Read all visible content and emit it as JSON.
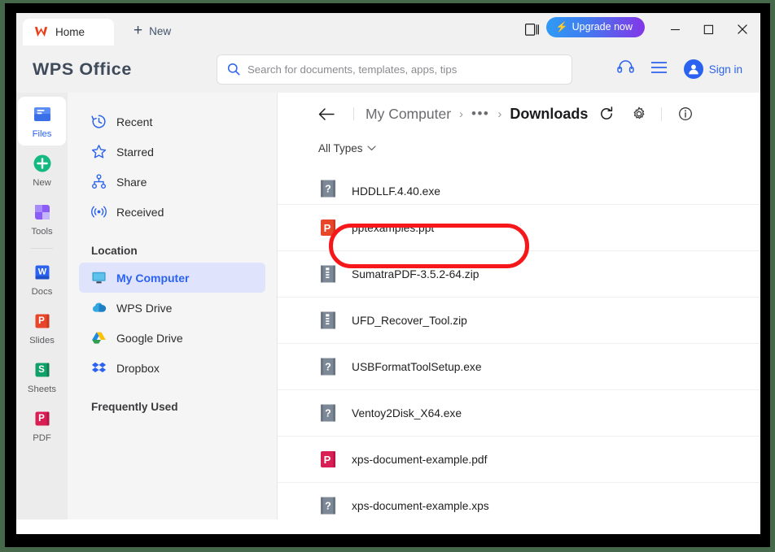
{
  "window": {
    "tabs": [
      {
        "label": "Home",
        "icon": "wps-logo-icon"
      }
    ],
    "new_tab_label": "New",
    "upgrade_label": "Upgrade now",
    "upgrade_icon": "lightning-bolt-icon",
    "sidebar_toggle_icon": "side-panel-icon",
    "minimize_icon": "minimize-icon",
    "maximize_icon": "maximize-icon",
    "close_icon": "close-icon"
  },
  "header": {
    "brand": "WPS Office",
    "search": {
      "placeholder": "Search for documents, templates, apps, tips",
      "icon": "search-icon"
    },
    "support_icon": "headset-icon",
    "menu_icon": "hamburger-menu-icon",
    "account": {
      "label": "Sign in",
      "icon": "user-avatar-icon"
    }
  },
  "rail": {
    "items": [
      {
        "label": "Files",
        "icon": "files-icon",
        "active": true
      },
      {
        "label": "New",
        "icon": "plus-circle-icon",
        "active": false
      },
      {
        "label": "Tools",
        "icon": "tools-grid-icon",
        "active": false
      },
      {
        "label": "Docs",
        "icon": "word-doc-icon",
        "active": false
      },
      {
        "label": "Slides",
        "icon": "powerpoint-icon",
        "active": false
      },
      {
        "label": "Sheets",
        "icon": "spreadsheet-icon",
        "active": false
      },
      {
        "label": "PDF",
        "icon": "pdf-icon",
        "active": false
      }
    ]
  },
  "nav": {
    "top_items": [
      {
        "label": "Recent",
        "icon": "history-clock-icon"
      },
      {
        "label": "Starred",
        "icon": "star-icon"
      },
      {
        "label": "Share",
        "icon": "share-nodes-icon"
      },
      {
        "label": "Received",
        "icon": "broadcast-icon"
      }
    ],
    "location_heading": "Location",
    "location_items": [
      {
        "label": "My Computer",
        "icon": "monitor-icon",
        "selected": true
      },
      {
        "label": "WPS Drive",
        "icon": "cloud-icon",
        "selected": false
      },
      {
        "label": "Google Drive",
        "icon": "google-drive-icon",
        "selected": false
      },
      {
        "label": "Dropbox",
        "icon": "dropbox-icon",
        "selected": false
      }
    ],
    "frequently_used_heading": "Frequently Used"
  },
  "content": {
    "breadcrumb": {
      "back_icon": "arrow-left-icon",
      "root": "My Computer",
      "ellipsis": "•••",
      "current": "Downloads",
      "refresh_icon": "refresh-icon",
      "settings_icon": "gear-icon",
      "info_icon": "info-icon"
    },
    "filter": {
      "label": "All Types",
      "icon": "chevron-down-icon"
    },
    "files": [
      {
        "name": "HDDLLF.4.40.exe",
        "icon": "unknown-file-icon",
        "clipped": true
      },
      {
        "name": "pptexamples.ppt",
        "icon": "powerpoint-file-icon",
        "highlighted": true
      },
      {
        "name": "SumatraPDF-3.5.2-64.zip",
        "icon": "archive-file-icon"
      },
      {
        "name": "UFD_Recover_Tool.zip",
        "icon": "archive-file-icon"
      },
      {
        "name": "USBFormatToolSetup.exe",
        "icon": "unknown-file-icon"
      },
      {
        "name": "Ventoy2Disk_X64.exe",
        "icon": "unknown-file-icon"
      },
      {
        "name": "xps-document-example.pdf",
        "icon": "pdf-file-icon"
      },
      {
        "name": "xps-document-example.xps",
        "icon": "unknown-file-icon"
      }
    ]
  },
  "annotation": {
    "shape": "rounded-rectangle-highlight",
    "color": "#f5171a",
    "targets": "pptexamples.ppt"
  },
  "colors": {
    "accent_blue": "#2b62f0",
    "annotation_red": "#f5171a",
    "selection_lavender": "#dfe3fb",
    "frame_black": "#000000",
    "desktop_green": "#46694b"
  }
}
